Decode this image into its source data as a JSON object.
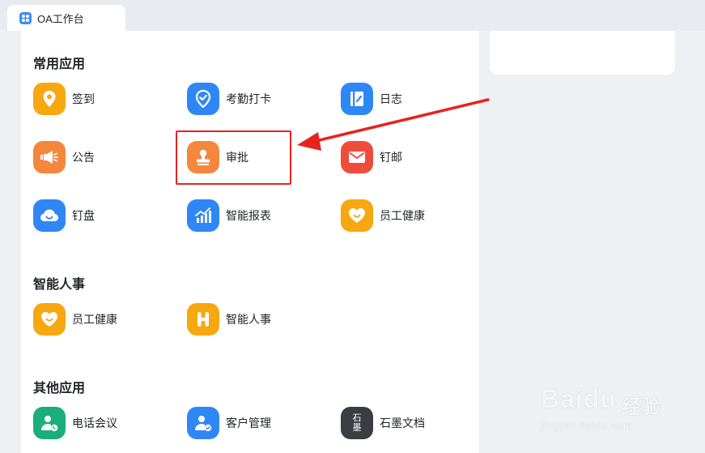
{
  "tab": {
    "title": "OA工作台"
  },
  "sections": {
    "common": {
      "title": "常用应用",
      "apps": [
        {
          "label": "签到",
          "icon": "location-pin-icon",
          "color": "#f7a70f"
        },
        {
          "label": "考勤打卡",
          "icon": "check-shield-icon",
          "color": "#2f87f6"
        },
        {
          "label": "日志",
          "icon": "journal-icon",
          "color": "#2f87f6"
        },
        {
          "label": "公告",
          "icon": "megaphone-icon",
          "color": "#f5873c"
        },
        {
          "label": "审批",
          "icon": "stamp-icon",
          "color": "#f5873c"
        },
        {
          "label": "钉邮",
          "icon": "mail-icon",
          "color": "#ef4d3c"
        },
        {
          "label": "钉盘",
          "icon": "cloud-icon",
          "color": "#2f87f6"
        },
        {
          "label": "智能报表",
          "icon": "bar-chart-icon",
          "color": "#2f87f6"
        },
        {
          "label": "员工健康",
          "icon": "heart-icon",
          "color": "#f7a70f"
        }
      ]
    },
    "hr": {
      "title": "智能人事",
      "apps": [
        {
          "label": "员工健康",
          "icon": "heart-icon",
          "color": "#f7a70f"
        },
        {
          "label": "智能人事",
          "icon": "h-letter-icon",
          "color": "#f7a70f"
        }
      ]
    },
    "other": {
      "title": "其他应用",
      "apps": [
        {
          "label": "电话会议",
          "icon": "phone-user-icon",
          "color": "#1bae7a"
        },
        {
          "label": "客户管理",
          "icon": "customer-icon",
          "color": "#2f87f6"
        },
        {
          "label": "石墨文档",
          "icon": "shimo-icon",
          "color": "#3a3d42",
          "icon_text": "石墨"
        }
      ]
    }
  },
  "watermark": {
    "logo": "Baidu",
    "cn": "经验",
    "url": "jingyan.baidu.com"
  },
  "annotation_color": "#e8231f"
}
